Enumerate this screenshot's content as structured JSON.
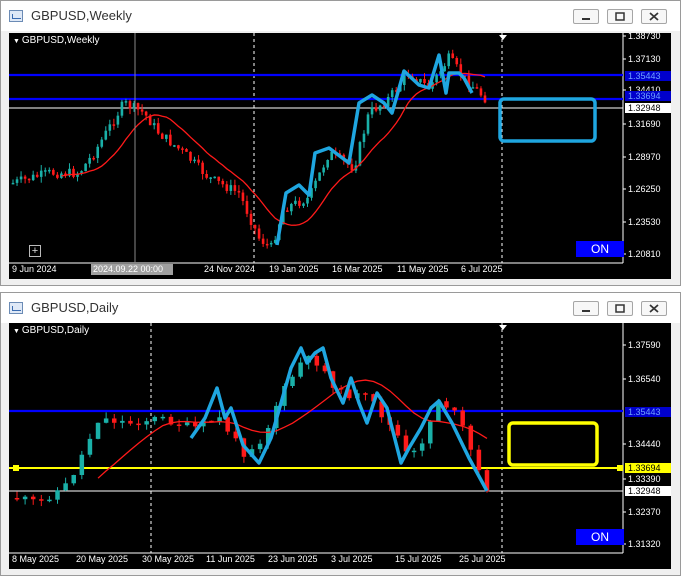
{
  "weekly": {
    "window_title": "GBPUSD,Weekly",
    "symbol_label": "GBPUSD,Weekly",
    "on_label": "ON",
    "price_labels": [
      "1.38730",
      "1.37130",
      "1.34410",
      "1.31690",
      "1.28970",
      "1.26250",
      "1.23530",
      "1.20810"
    ],
    "price_tags": [
      {
        "text": "1.35443",
        "bg": "#0000cc"
      },
      {
        "text": "1.33694",
        "bg": "#0000cc"
      },
      {
        "text": "1.32948",
        "bg": "#ffffff"
      }
    ],
    "date_labels": [
      "9 Jun 2024",
      "4 Aug 2024",
      "24 Nov 2024",
      "19 Jan 2025",
      "16 Mar 2025",
      "11 May 2025",
      "6 Jul 2025"
    ],
    "crosshair_label": "2024.09.22 00:00",
    "box_color": "#1fa6e0"
  },
  "daily": {
    "window_title": "GBPUSD,Daily",
    "symbol_label": "GBPUSD,Daily",
    "on_label": "ON",
    "price_labels": [
      "1.37590",
      "1.36540",
      "1.34440",
      "1.33390",
      "1.32370",
      "1.31320"
    ],
    "price_tags": [
      {
        "text": "1.35443",
        "bg": "#0000cc"
      },
      {
        "text": "1.33694",
        "bg": "#ffff00"
      },
      {
        "text": "1.32948",
        "bg": "#ffffff"
      }
    ],
    "date_labels": [
      "8 May 2025",
      "20 May 2025",
      "30 May 2025",
      "11 Jun 2025",
      "23 Jun 2025",
      "3 Jul 2025",
      "15 Jul 2025",
      "25 Jul 2025"
    ],
    "box_color": "#ffff00"
  },
  "colors": {
    "bull": "#1ab0a8",
    "bear": "#ff1a1a",
    "ma": "#ff1a1a",
    "blue_level": "#0000ff",
    "wave": "#1fa6e0"
  }
}
